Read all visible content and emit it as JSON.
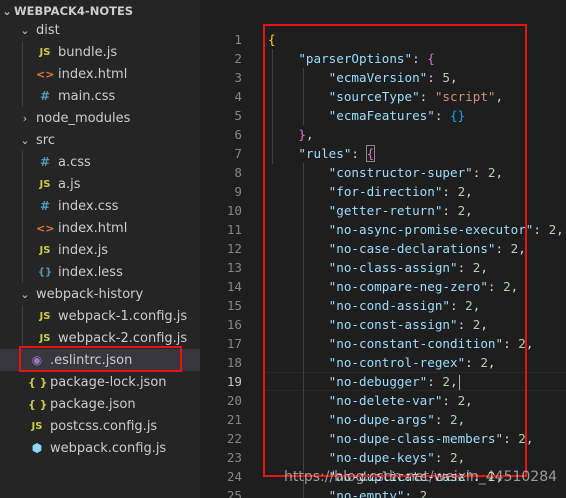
{
  "explorer": {
    "root": "WEBPACK4-NOTES",
    "items": [
      {
        "label": "dist",
        "icon": "chevron-down-icon"
      },
      {
        "label": "bundle.js",
        "icon": "js-file-icon"
      },
      {
        "label": "index.html",
        "icon": "html-file-icon"
      },
      {
        "label": "main.css",
        "icon": "css-file-icon"
      },
      {
        "label": "node_modules",
        "icon": "chevron-right-icon"
      },
      {
        "label": "src",
        "icon": "chevron-down-icon"
      },
      {
        "label": "a.css",
        "icon": "css-file-icon"
      },
      {
        "label": "a.js",
        "icon": "js-file-icon"
      },
      {
        "label": "index.css",
        "icon": "css-file-icon"
      },
      {
        "label": "index.html",
        "icon": "html-file-icon"
      },
      {
        "label": "index.js",
        "icon": "js-file-icon"
      },
      {
        "label": "index.less",
        "icon": "less-file-icon"
      },
      {
        "label": "webpack-history",
        "icon": "chevron-down-icon"
      },
      {
        "label": "webpack-1.config.js",
        "icon": "js-file-icon"
      },
      {
        "label": "webpack-2.config.js",
        "icon": "js-file-icon"
      },
      {
        "label": ".eslintrc.json",
        "icon": "eslint-file-icon"
      },
      {
        "label": "package-lock.json",
        "icon": "json-file-icon"
      },
      {
        "label": "package.json",
        "icon": "json-file-icon"
      },
      {
        "label": "postcss.config.js",
        "icon": "js-file-icon"
      },
      {
        "label": "webpack.config.js",
        "icon": "webpack-file-icon"
      }
    ],
    "selected": ".eslintrc.json"
  },
  "icon_glyphs": {
    "js": "JS",
    "html": "<>",
    "css": "#",
    "json": "{ }",
    "less": "{}",
    "eslint": "◉",
    "webpack": "⬢",
    "chevron_down": "⌄",
    "chevron_right": "›"
  },
  "editor": {
    "line_numbers": [
      "1",
      "2",
      "3",
      "4",
      "5",
      "6",
      "7",
      "8",
      "9",
      "10",
      "11",
      "12",
      "13",
      "14",
      "15",
      "16",
      "17",
      "18",
      "19",
      "20",
      "21",
      "22",
      "23",
      "24",
      "25"
    ],
    "current_line": "19",
    "lines": [
      {
        "k": "",
        "v": "",
        "open": "{"
      },
      {
        "k": "\"parserOptions\"",
        "v": "",
        "open": "{"
      },
      {
        "k": "\"ecmaVersion\"",
        "v": "5",
        "vt": "n"
      },
      {
        "k": "\"sourceType\"",
        "v": "\"script\"",
        "vt": "s"
      },
      {
        "k": "\"ecmaFeatures\"",
        "v": "{}",
        "vt": "b"
      },
      {
        "close": "},"
      },
      {
        "k": "\"rules\"",
        "v": "",
        "open": "{"
      },
      {
        "k": "\"constructor-super\"",
        "v": "2"
      },
      {
        "k": "\"for-direction\"",
        "v": "2"
      },
      {
        "k": "\"getter-return\"",
        "v": "2"
      },
      {
        "k": "\"no-async-promise-executor\"",
        "v": "2"
      },
      {
        "k": "\"no-case-declarations\"",
        "v": "2"
      },
      {
        "k": "\"no-class-assign\"",
        "v": "2"
      },
      {
        "k": "\"no-compare-neg-zero\"",
        "v": "2"
      },
      {
        "k": "\"no-cond-assign\"",
        "v": "2"
      },
      {
        "k": "\"no-const-assign\"",
        "v": "2"
      },
      {
        "k": "\"no-constant-condition\"",
        "v": "2"
      },
      {
        "k": "\"no-control-regex\"",
        "v": "2"
      },
      {
        "k": "\"no-debugger\"",
        "v": "2"
      },
      {
        "k": "\"no-delete-var\"",
        "v": "2"
      },
      {
        "k": "\"no-dupe-args\"",
        "v": "2"
      },
      {
        "k": "\"no-dupe-class-members\"",
        "v": "2"
      },
      {
        "k": "\"no-dupe-keys\"",
        "v": "2"
      },
      {
        "k": "\"no-duplicate-case\"",
        "v": "2"
      },
      {
        "k": "\"no-empty\"",
        "v": "2"
      }
    ]
  },
  "watermark": "https://blog.csdn.net/weixin_44510284",
  "colors": {
    "highlight_box": "#e51414",
    "selection_bg": "#37373d"
  }
}
